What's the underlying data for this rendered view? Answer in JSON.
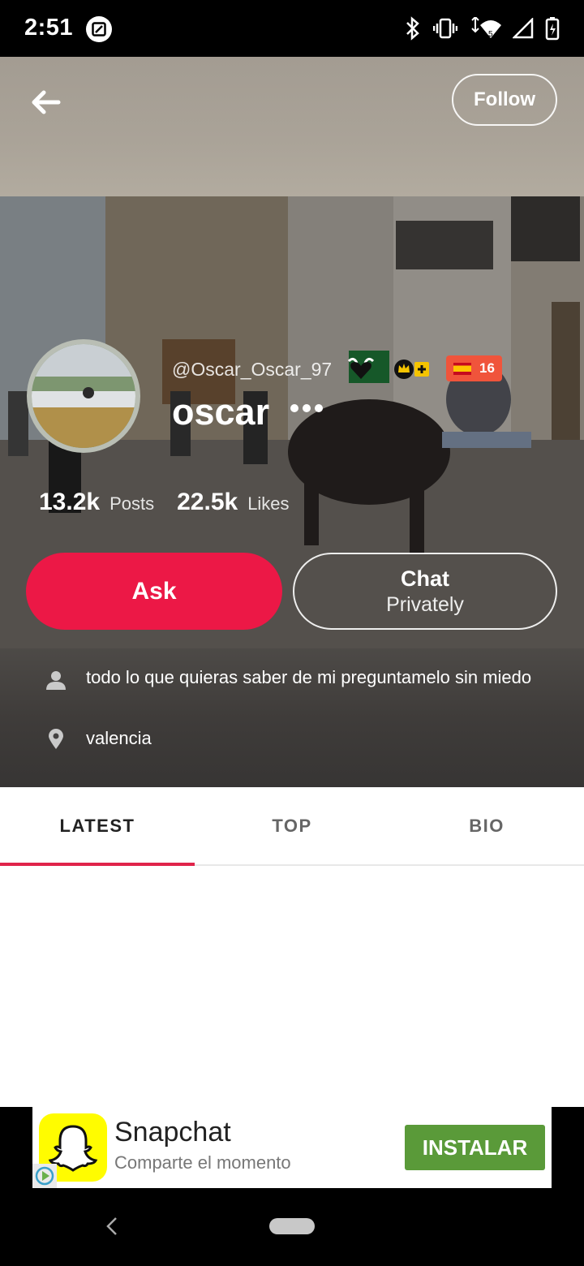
{
  "status_bar": {
    "time": "2:51",
    "icons": [
      "screenshot-icon",
      "bluetooth-icon",
      "vibrate-icon",
      "wifi-icon",
      "signal-icon",
      "battery-icon"
    ]
  },
  "header": {
    "back_icon": "arrow-left-icon",
    "follow_label": "Follow"
  },
  "profile": {
    "handle": "@Oscar_Oscar_97",
    "name": "oscar",
    "flag_count": "16",
    "stats": [
      {
        "value": "13.2k",
        "label": "Posts"
      },
      {
        "value": "22.5k",
        "label": "Likes"
      }
    ],
    "ask_label": "Ask",
    "chat_label_line1": "Chat",
    "chat_label_line2": "Privately"
  },
  "bio": {
    "about": "todo lo que quieras saber de mi preguntamelo sin miedo",
    "location": "valencia"
  },
  "tabs": [
    {
      "label": "LATEST",
      "active": true
    },
    {
      "label": "TOP",
      "active": false
    },
    {
      "label": "BIO",
      "active": false
    }
  ],
  "ad": {
    "title": "Snapchat",
    "subtitle": "Comparte el momento",
    "cta": "INSTALAR"
  },
  "colors": {
    "accent": "#ec1846",
    "tab_indicator": "#e0234a",
    "ad_cta": "#5a9a39",
    "flag_badge": "#f0543b"
  }
}
